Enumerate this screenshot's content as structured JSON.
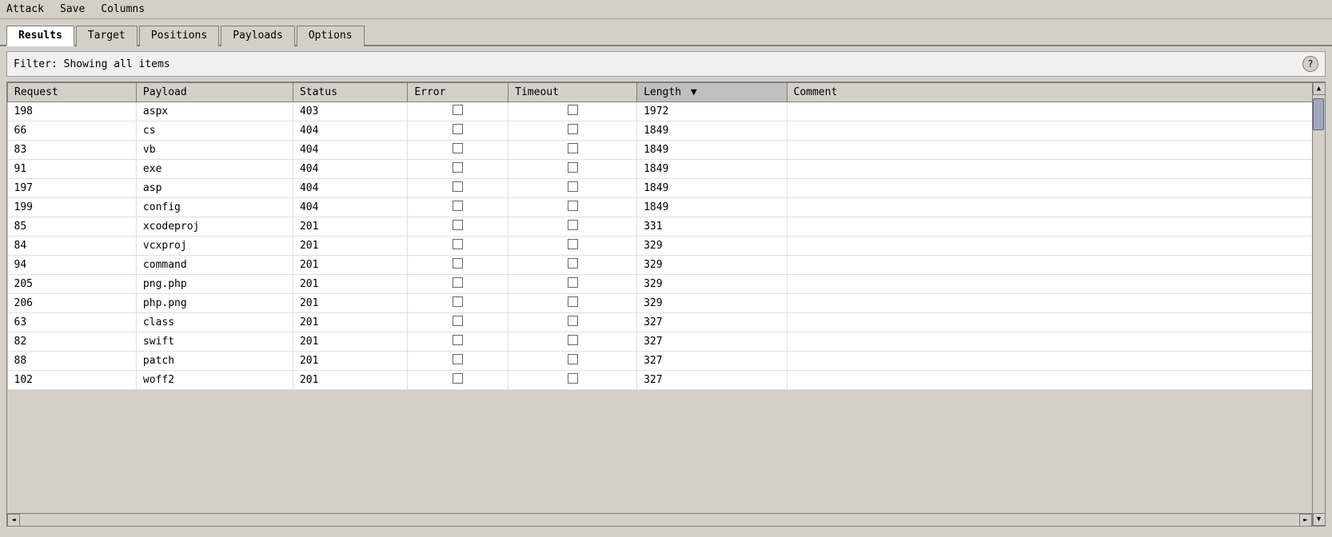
{
  "menuBar": {
    "items": [
      "Attack",
      "Save",
      "Columns"
    ]
  },
  "tabs": [
    {
      "label": "Results",
      "active": true
    },
    {
      "label": "Target",
      "active": false
    },
    {
      "label": "Positions",
      "active": false
    },
    {
      "label": "Payloads",
      "active": false
    },
    {
      "label": "Options",
      "active": false
    }
  ],
  "filter": {
    "text": "Filter: Showing all items"
  },
  "help": "?",
  "table": {
    "columns": [
      {
        "label": "Request",
        "key": "request",
        "sorted": false
      },
      {
        "label": "Payload",
        "key": "payload",
        "sorted": false
      },
      {
        "label": "Status",
        "key": "status",
        "sorted": false
      },
      {
        "label": "Error",
        "key": "error",
        "sorted": false
      },
      {
        "label": "Timeout",
        "key": "timeout",
        "sorted": false
      },
      {
        "label": "Length",
        "key": "length",
        "sorted": true
      },
      {
        "label": "Comment",
        "key": "comment",
        "sorted": false
      }
    ],
    "rows": [
      {
        "request": "198",
        "payload": "aspx",
        "status": "403",
        "error": false,
        "timeout": false,
        "length": "1972",
        "comment": ""
      },
      {
        "request": "66",
        "payload": "cs",
        "status": "404",
        "error": false,
        "timeout": false,
        "length": "1849",
        "comment": ""
      },
      {
        "request": "83",
        "payload": "vb",
        "status": "404",
        "error": false,
        "timeout": false,
        "length": "1849",
        "comment": ""
      },
      {
        "request": "91",
        "payload": "exe",
        "status": "404",
        "error": false,
        "timeout": false,
        "length": "1849",
        "comment": ""
      },
      {
        "request": "197",
        "payload": "asp",
        "status": "404",
        "error": false,
        "timeout": false,
        "length": "1849",
        "comment": ""
      },
      {
        "request": "199",
        "payload": "config",
        "status": "404",
        "error": false,
        "timeout": false,
        "length": "1849",
        "comment": ""
      },
      {
        "request": "85",
        "payload": "xcodeproj",
        "status": "201",
        "error": false,
        "timeout": false,
        "length": "331",
        "comment": ""
      },
      {
        "request": "84",
        "payload": "vcxproj",
        "status": "201",
        "error": false,
        "timeout": false,
        "length": "329",
        "comment": ""
      },
      {
        "request": "94",
        "payload": "command",
        "status": "201",
        "error": false,
        "timeout": false,
        "length": "329",
        "comment": ""
      },
      {
        "request": "205",
        "payload": "png.php",
        "status": "201",
        "error": false,
        "timeout": false,
        "length": "329",
        "comment": ""
      },
      {
        "request": "206",
        "payload": "php.png",
        "status": "201",
        "error": false,
        "timeout": false,
        "length": "329",
        "comment": ""
      },
      {
        "request": "63",
        "payload": "class",
        "status": "201",
        "error": false,
        "timeout": false,
        "length": "327",
        "comment": ""
      },
      {
        "request": "82",
        "payload": "swift",
        "status": "201",
        "error": false,
        "timeout": false,
        "length": "327",
        "comment": ""
      },
      {
        "request": "88",
        "payload": "patch",
        "status": "201",
        "error": false,
        "timeout": false,
        "length": "327",
        "comment": ""
      },
      {
        "request": "102",
        "payload": "woff2",
        "status": "201",
        "error": false,
        "timeout": false,
        "length": "327",
        "comment": ""
      }
    ]
  },
  "scrollbar": {
    "up_arrow": "▲",
    "down_arrow": "▼",
    "left_arrow": "◄",
    "right_arrow": "►"
  }
}
